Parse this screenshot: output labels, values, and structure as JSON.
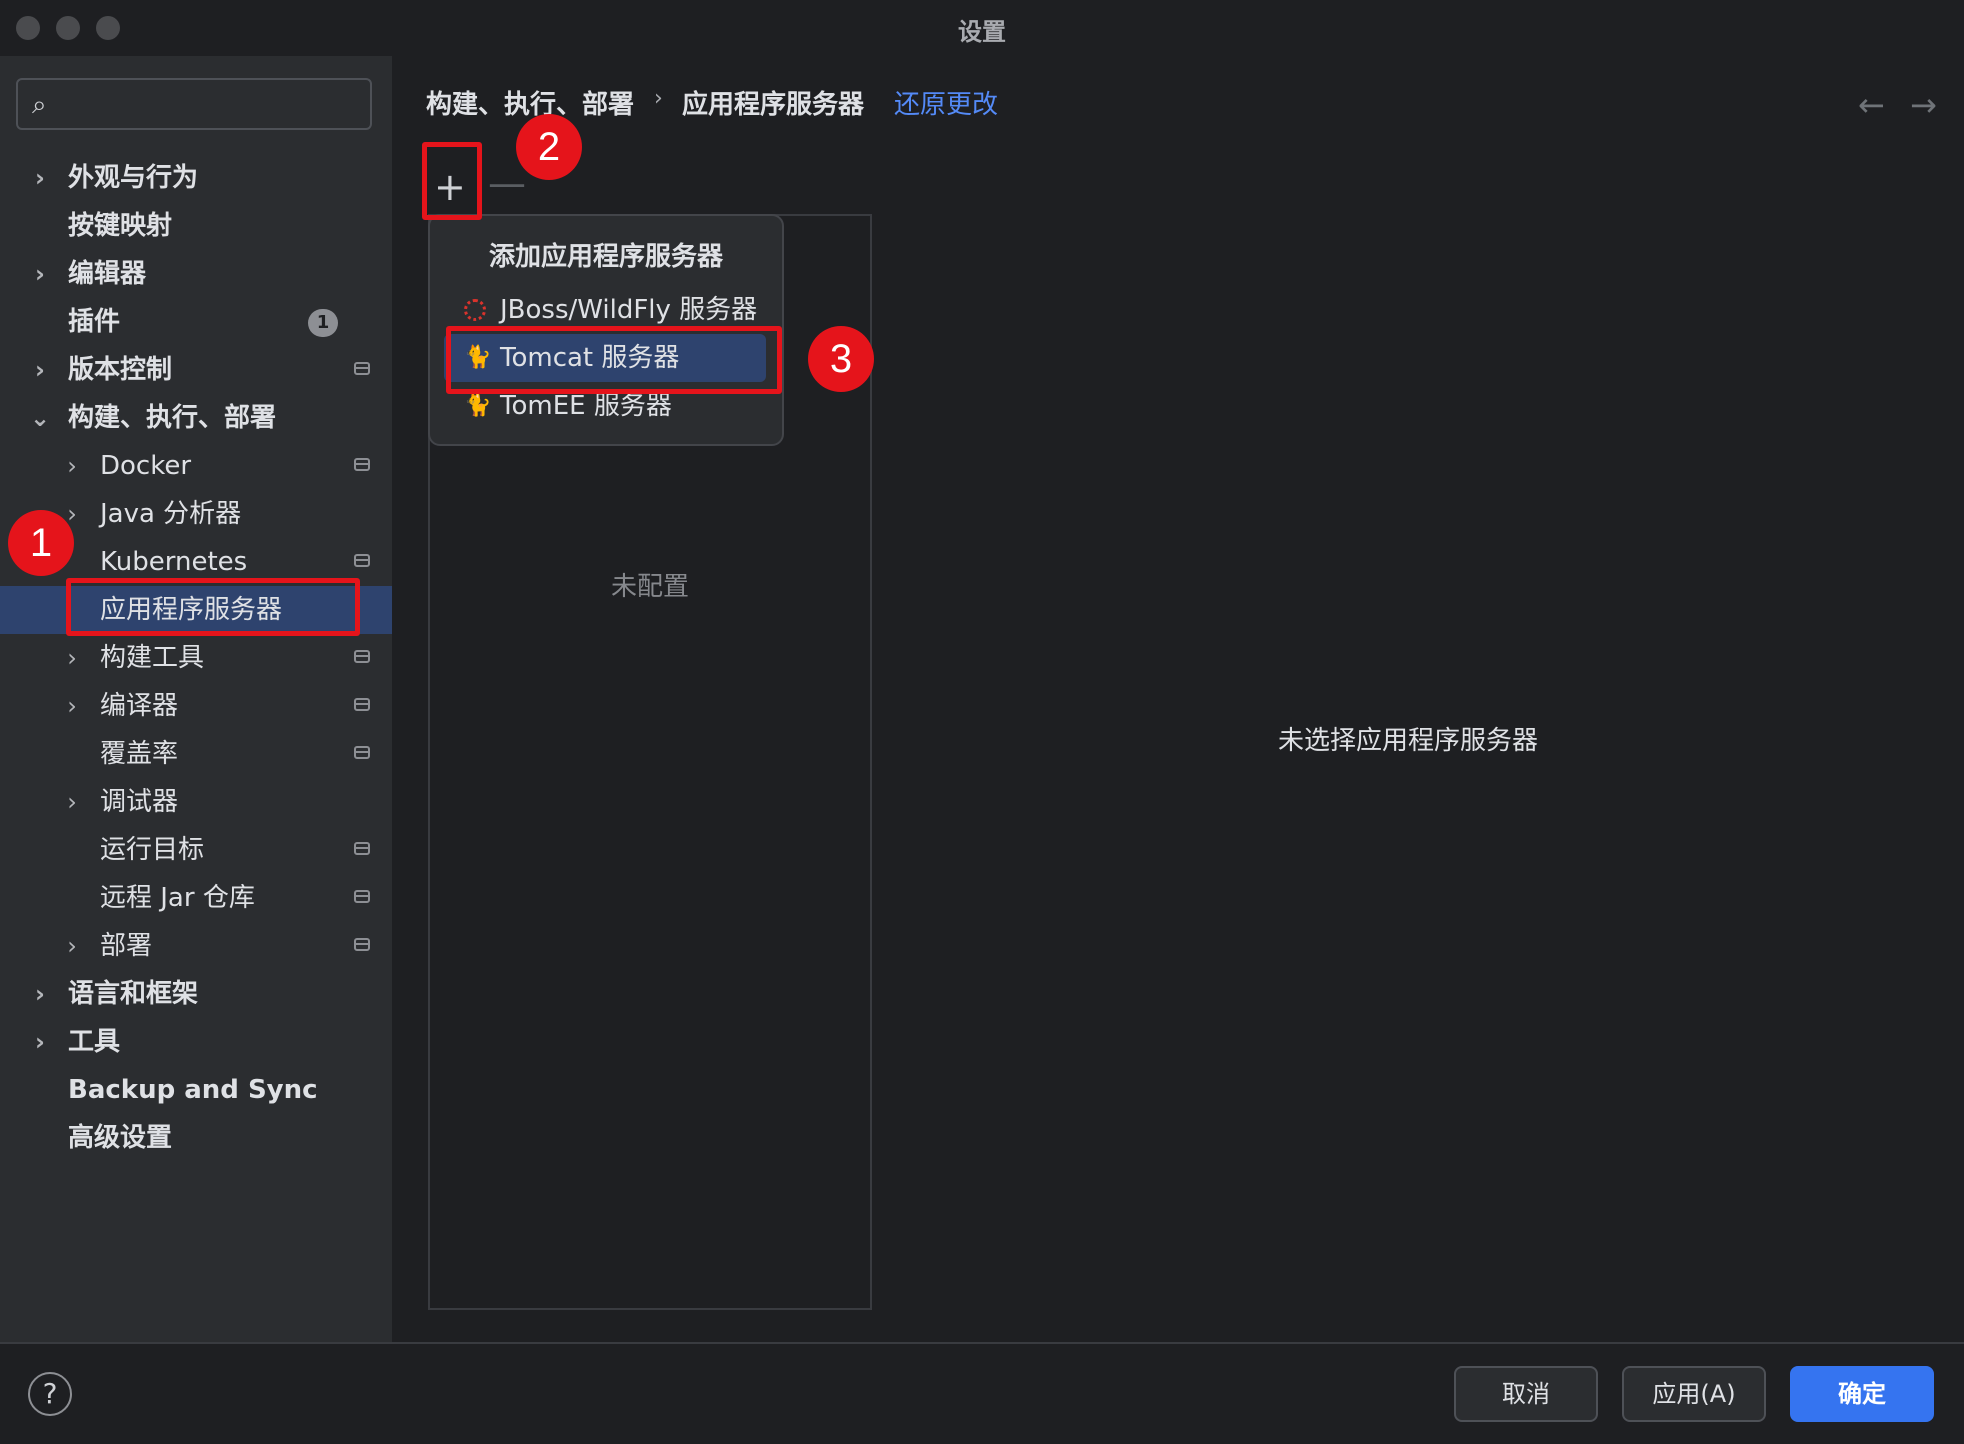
{
  "window": {
    "title": "设置"
  },
  "search": {
    "placeholder": ""
  },
  "sidebar": {
    "items": [
      {
        "label": "外观与行为",
        "chevron": "›",
        "bold": true
      },
      {
        "label": "按键映射",
        "bold": true
      },
      {
        "label": "编辑器",
        "chevron": "›",
        "bold": true
      },
      {
        "label": "插件",
        "bold": true,
        "badge": "1"
      },
      {
        "label": "版本控制",
        "chevron": "›",
        "bold": true
      },
      {
        "label": "构建、执行、部署",
        "chevron": "⌄",
        "bold": true
      },
      {
        "label": "Docker",
        "chevron": "›"
      },
      {
        "label": "Java 分析器",
        "chevron": "›"
      },
      {
        "label": "Kubernetes"
      },
      {
        "label": "应用程序服务器"
      },
      {
        "label": "构建工具",
        "chevron": "›"
      },
      {
        "label": "编译器",
        "chevron": "›"
      },
      {
        "label": "覆盖率"
      },
      {
        "label": "调试器",
        "chevron": "›"
      },
      {
        "label": "运行目标"
      },
      {
        "label": "远程 Jar 仓库"
      },
      {
        "label": "部署",
        "chevron": "›"
      },
      {
        "label": "语言和框架",
        "chevron": "›",
        "bold": true
      },
      {
        "label": "工具",
        "chevron": "›",
        "bold": true
      },
      {
        "label": "Backup and Sync",
        "bold": true
      },
      {
        "label": "高级设置",
        "bold": true
      }
    ]
  },
  "breadcrumb": {
    "parent": "构建、执行、部署",
    "sep": "›",
    "current": "应用程序服务器",
    "revert": "还原更改"
  },
  "toolbar": {
    "add": "+",
    "remove": "—",
    "back": "←",
    "forward": "→"
  },
  "list": {
    "empty": "未配置"
  },
  "detail": {
    "empty": "未选择应用程序服务器"
  },
  "popup": {
    "title": "添加应用程序服务器",
    "items": [
      {
        "label": "JBoss/WildFly 服务器",
        "icon": "jboss-icon"
      },
      {
        "label": "Tomcat 服务器",
        "icon": "tomcat-icon"
      },
      {
        "label": "TomEE 服务器",
        "icon": "tomee-icon"
      }
    ]
  },
  "steps": {
    "one": "1",
    "two": "2",
    "three": "3"
  },
  "footer": {
    "help": "?",
    "cancel": "取消",
    "apply": "应用(A)",
    "ok": "确定"
  }
}
